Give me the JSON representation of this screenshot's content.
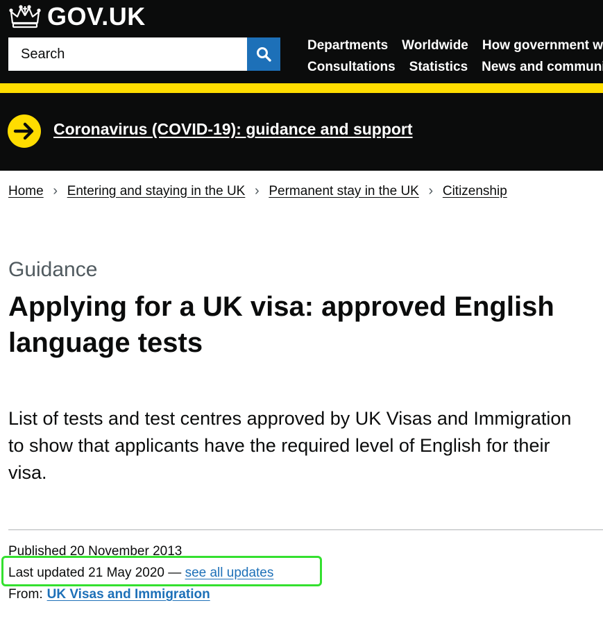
{
  "header": {
    "logo_text": "GOV.UK",
    "search": {
      "placeholder": "Search",
      "button_icon": "search-icon"
    },
    "nav_row1": [
      "Departments",
      "Worldwide",
      "How government works"
    ],
    "nav_row2": [
      "Consultations",
      "Statistics",
      "News and communications"
    ],
    "colors": {
      "background": "#0b0c0c",
      "accent": "#ffdd00",
      "search_button": "#1d70b8"
    }
  },
  "banner": {
    "icon": "arrow-right-icon",
    "link": "Coronavirus (COVID-19): guidance and support"
  },
  "breadcrumbs": [
    "Home",
    "Entering and staying in the UK",
    "Permanent stay in the UK",
    "Citizenship"
  ],
  "main": {
    "caption": "Guidance",
    "title": "Applying for a UK visa: approved English language tests",
    "lead": "List of tests and test centres approved by UK Visas and Immigration to show that applicants have the required level of English for their visa."
  },
  "metadata": {
    "published": "Published 20 November 2013",
    "last_updated": "Last updated 21 May 2020 — ",
    "see_all_updates": "see all updates",
    "from_label": "From:",
    "from_link": "UK Visas and Immigration",
    "highlight_color": "#34e02f"
  }
}
